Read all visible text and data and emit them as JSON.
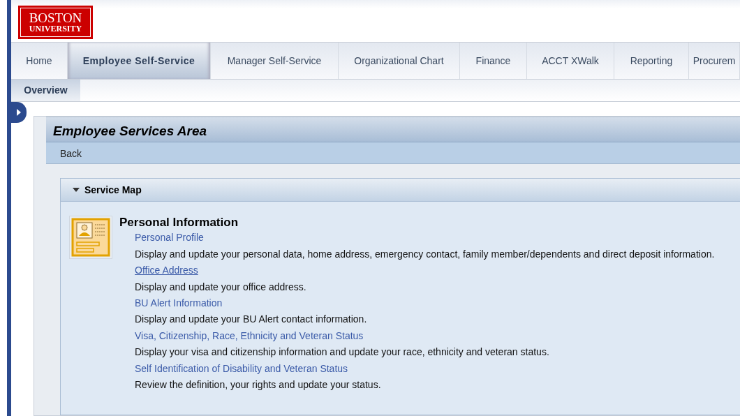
{
  "logo": {
    "line_1": "BOSTON",
    "line_2": "UNIVERSITY"
  },
  "tabs": [
    {
      "label": "Home",
      "selected": false
    },
    {
      "label": "Employee Self-Service",
      "selected": true
    },
    {
      "label": "Manager Self-Service",
      "selected": false
    },
    {
      "label": "Organizational Chart",
      "selected": false
    },
    {
      "label": "Finance",
      "selected": false
    },
    {
      "label": "ACCT XWalk",
      "selected": false
    },
    {
      "label": "Reporting",
      "selected": false
    },
    {
      "label": "Procurem",
      "selected": false
    }
  ],
  "subtabs": [
    {
      "label": "Overview",
      "selected": true
    }
  ],
  "page": {
    "title": "Employee Services Area",
    "back": "Back"
  },
  "service_map": {
    "title": "Service Map",
    "expanded": true,
    "section": {
      "heading": "Personal Information",
      "services": [
        {
          "link": "Personal Profile",
          "underlined": false,
          "description": "Display and update your personal data, home address, emergency contact, family member/dependents and direct deposit information."
        },
        {
          "link": "Office Address",
          "underlined": true,
          "description": "Display and update your office address."
        },
        {
          "link": "BU Alert Information",
          "underlined": false,
          "description": "Display and update your BU Alert contact information."
        },
        {
          "link": "Visa, Citizenship, Race, Ethnicity and Veteran Status",
          "underlined": false,
          "description": "Display your visa and citizenship information and update your race, ethnicity and veteran status."
        },
        {
          "link": "Self Identification of Disability and Veteran Status",
          "underlined": false,
          "description": "Review  the definition, your rights and update your status."
        }
      ]
    }
  }
}
